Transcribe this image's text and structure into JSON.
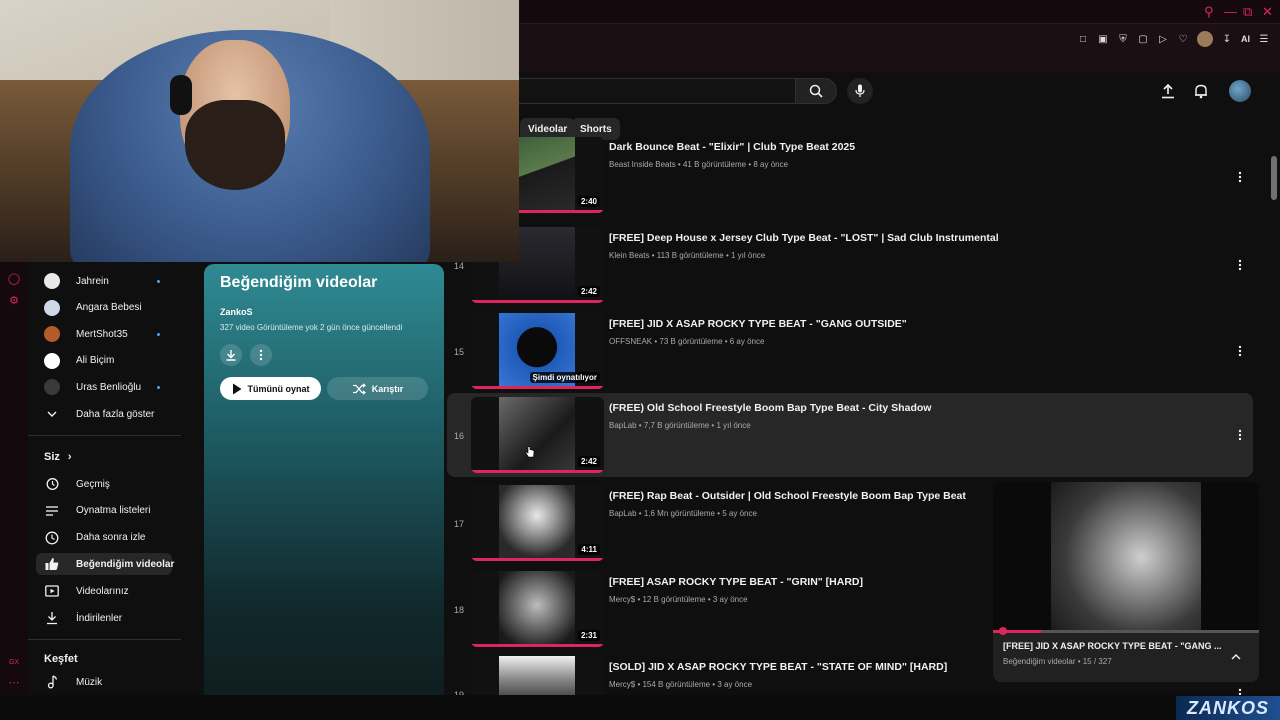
{
  "search": {
    "placeholder": ""
  },
  "chips": [
    "Videolar",
    "Shorts"
  ],
  "sidebar": {
    "subscriptions": [
      {
        "name": "Jahrein",
        "dot": true,
        "color": "#e8e8e8"
      },
      {
        "name": "Angara Bebesi",
        "dot": false,
        "color": "#cfd8e6"
      },
      {
        "name": "MertShot35",
        "dot": true,
        "color": "#b55a2a"
      },
      {
        "name": "Ali Biçim",
        "dot": false,
        "color": "#ffffff"
      },
      {
        "name": "Uras Benlioğlu",
        "dot": true,
        "color": "#3a3a3a"
      }
    ],
    "show_more": "Daha fazla göster",
    "you_section": "Siz",
    "you_items": [
      {
        "label": "Geçmiş",
        "icon": "history-icon"
      },
      {
        "label": "Oynatma listeleri",
        "icon": "playlists-icon"
      },
      {
        "label": "Daha sonra izle",
        "icon": "watch-later-icon"
      },
      {
        "label": "Beğendiğim videolar",
        "icon": "like-icon",
        "active": true
      },
      {
        "label": "Videolarınız",
        "icon": "your-videos-icon"
      },
      {
        "label": "İndirilenler",
        "icon": "download-icon"
      }
    ],
    "explore_section": "Keşfet",
    "explore_items": [
      {
        "label": "Müzik",
        "icon": "music-icon"
      }
    ]
  },
  "playlist": {
    "title": "Beğendiğim videolar",
    "owner": "ZankoS",
    "meta": "327 video  Görüntüleme yok  2 gün önce güncellendi",
    "play_all": "Tümünü oynat",
    "shuffle": "Karıştır"
  },
  "videos": [
    {
      "index": "",
      "title": "Dark Bounce Beat - \"Elixir\" | Club Type Beat 2025",
      "meta": "Beast Inside Beats • 41 B görüntüleme • 8 ay önce",
      "duration": "2:40",
      "partial": true
    },
    {
      "index": "14",
      "title": "[FREE] Deep House x Jersey Club Type Beat - \"LOST\" | Sad Club Instrumental",
      "meta": "Klein Beats • 113 B görüntüleme • 1 yıl önce",
      "duration": "2:42"
    },
    {
      "index": "15",
      "title": "[FREE] JID X ASAP ROCKY TYPE BEAT - \"GANG OUTSIDE\"",
      "meta": "OFFSNEAK • 73 B görüntüleme • 6 ay önce",
      "duration": "",
      "now_playing": "Şimdi oynatılıyor"
    },
    {
      "index": "16",
      "title": "(FREE) Old School Freestyle Boom Bap Type Beat - City Shadow",
      "meta": "BapLab • 7,7 B görüntüleme • 1 yıl önce",
      "duration": "2:42",
      "hover": true
    },
    {
      "index": "17",
      "title": "(FREE) Rap Beat - Outsider | Old School Freestyle Boom Bap Type Beat",
      "meta": "BapLab • 1,6 Mn görüntüleme • 5 ay önce",
      "duration": "4:11"
    },
    {
      "index": "18",
      "title": "[FREE] ASAP ROCKY TYPE BEAT - \"GRIN\" [HARD]",
      "meta": "Mercy$ • 12 B görüntüleme • 3 ay önce",
      "duration": "2:31"
    },
    {
      "index": "19",
      "title": "[SOLD] JID X ASAP ROCKY TYPE BEAT - \"STATE OF MIND\" [HARD]",
      "meta": "Mercy$ • 154 B görüntüleme • 3 ay önce",
      "duration": ""
    }
  ],
  "miniplayer": {
    "title": "[FREE] JID X ASAP ROCKY TYPE BEAT - \"GANG ...",
    "subtitle": "Beğendiğim videolar • 15 / 327",
    "progress_fraction": 0.18
  },
  "extensions": {
    "ai_label": "AI"
  },
  "watermark": "ZANKOS",
  "colors": {
    "accent": "#e0245e",
    "progress": "#e0245e",
    "panel_top": "#2f8a93"
  }
}
